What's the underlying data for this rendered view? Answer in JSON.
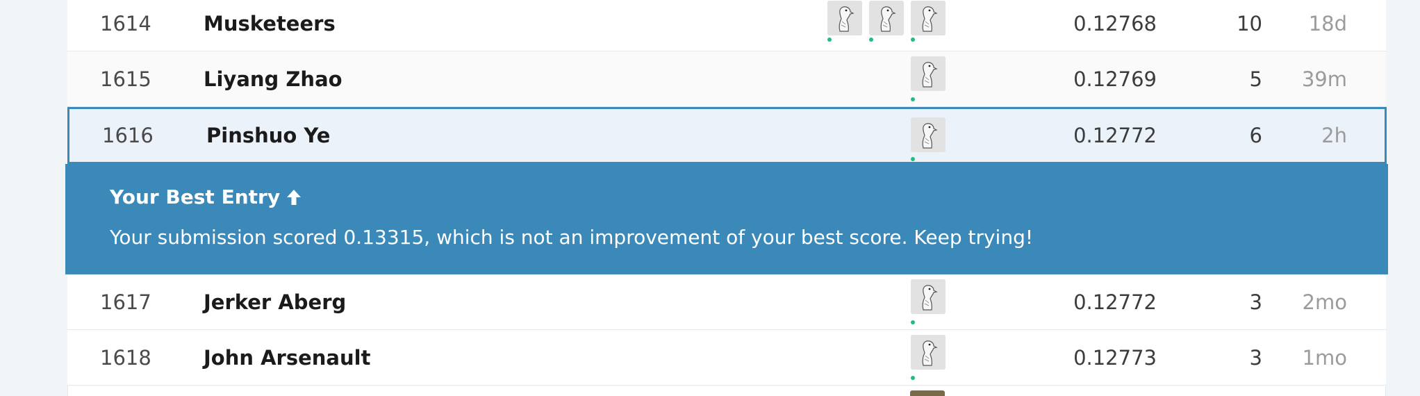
{
  "leaderboard": {
    "rows": [
      {
        "rank": "1614",
        "team": "Musketeers",
        "score": "0.12768",
        "entries": "10",
        "last": "18d"
      },
      {
        "rank": "1615",
        "team": "Liyang Zhao",
        "score": "0.12769",
        "entries": "5",
        "last": "39m"
      },
      {
        "rank": "1616",
        "team": "Pinshuo Ye",
        "score": "0.12772",
        "entries": "6",
        "last": "2h"
      },
      {
        "rank": "1617",
        "team": "Jerker Aberg",
        "score": "0.12772",
        "entries": "3",
        "last": "2mo"
      },
      {
        "rank": "1618",
        "team": "John Arsenault",
        "score": "0.12773",
        "entries": "3",
        "last": "1mo"
      }
    ]
  },
  "banner": {
    "title": "Your Best Entry",
    "title_icon": "arrow-up-icon",
    "message": "Your submission scored 0.13315, which is not an improvement of your best score. Keep trying!"
  },
  "colors": {
    "banner": "#3a89b8",
    "highlight_row": "#ecf2fa",
    "online_dot": "#20be7f"
  },
  "icons": {
    "avatar": "goose-avatar-icon"
  }
}
